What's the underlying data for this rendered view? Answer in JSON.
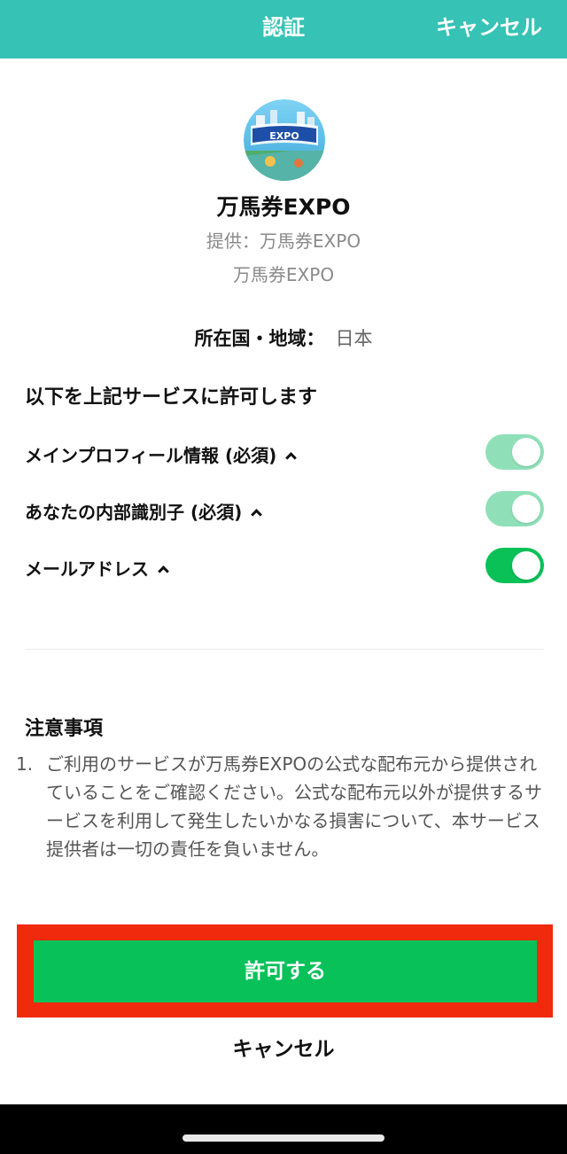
{
  "header": {
    "title": "認証",
    "cancel_label": "キャンセル",
    "color": "#36c2b5"
  },
  "app": {
    "name": "万馬券EXPO",
    "provider": "提供：万馬券EXPO",
    "subtitle": "万馬券EXPO",
    "icon": "app-logo-icon"
  },
  "region": {
    "label": "所在国・地域：",
    "value": "日本"
  },
  "permissions": {
    "heading": "以下を上記サービスに許可します",
    "items": [
      {
        "label": "メインプロフィール情報 (必須)",
        "enabled": true,
        "locked": true
      },
      {
        "label": "あなたの内部識別子 (必須)",
        "enabled": true,
        "locked": true
      },
      {
        "label": "メールアドレス",
        "enabled": true,
        "locked": false
      }
    ]
  },
  "notes": {
    "heading": "注意事項",
    "items": [
      {
        "num": "1.",
        "text": "ご利用のサービスが万馬券EXPOの公式な配布元から提供されていることをご確認ください。公式な配布元以外が提供するサービスを利用して発生したいかなる損害について、本サービス提供者は一切の責任を負いません。"
      }
    ]
  },
  "actions": {
    "allow_label": "許可する",
    "cancel_label": "キャンセル",
    "allow_color": "#08c159",
    "highlight_color": "#f02a0c"
  }
}
